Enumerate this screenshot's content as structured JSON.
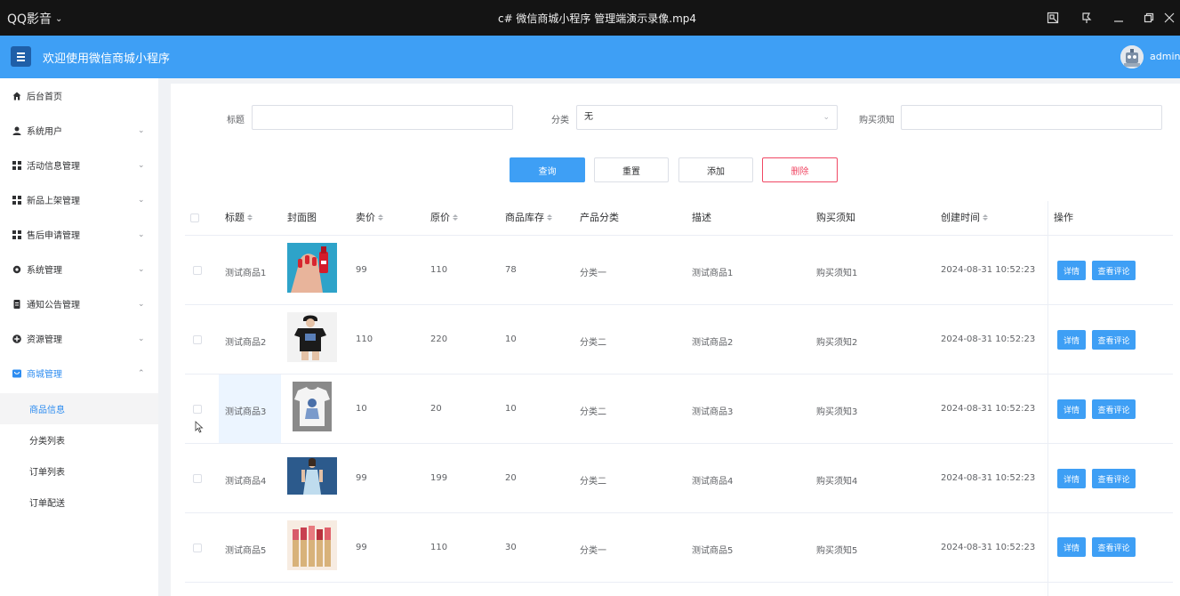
{
  "player": {
    "brand": "QQ影音",
    "title": "c# 微信商城小程序 管理端演示录像.mp4"
  },
  "header": {
    "title": "欢迎使用微信商城小程序",
    "user": "admin"
  },
  "sidebar": {
    "items": [
      {
        "label": "后台首页",
        "icon": "home-icon"
      },
      {
        "label": "系统用户",
        "icon": "user-icon"
      },
      {
        "label": "活动信息管理",
        "icon": "grid-icon"
      },
      {
        "label": "新品上架管理",
        "icon": "grid-icon"
      },
      {
        "label": "售后申请管理",
        "icon": "grid-icon"
      },
      {
        "label": "系统管理",
        "icon": "gear-icon"
      },
      {
        "label": "通知公告管理",
        "icon": "document-icon"
      },
      {
        "label": "资源管理",
        "icon": "plus-circle-icon"
      },
      {
        "label": "商城管理",
        "icon": "shop-icon"
      }
    ],
    "subitems": [
      "商品信息",
      "分类列表",
      "订单列表",
      "订单配送"
    ]
  },
  "filters": {
    "title_label": "标题",
    "title_value": "",
    "category_label": "分类",
    "category_value": "无",
    "notice_label": "购买须知",
    "notice_value": ""
  },
  "actions": {
    "query": "查询",
    "reset": "重置",
    "add": "添加",
    "delete": "删除"
  },
  "table": {
    "headers": {
      "title": "标题",
      "cover": "封面图",
      "price": "卖价",
      "original_price": "原价",
      "stock": "商品库存",
      "category": "产品分类",
      "description": "描述",
      "notice": "购买须知",
      "created": "创建时间",
      "ops": "操作"
    },
    "detail_label": "详情",
    "review_label": "查看评论",
    "rows": [
      {
        "title": "测试商品1",
        "cover": "nail-polish",
        "price": "99",
        "original": "110",
        "stock": "78",
        "category": "分类一",
        "desc": "测试商品1",
        "notice": "购买须知1",
        "created": "2024-08-31 10:52:23"
      },
      {
        "title": "测试商品2",
        "cover": "black-tshirt",
        "price": "110",
        "original": "220",
        "stock": "10",
        "category": "分类二",
        "desc": "测试商品2",
        "notice": "购买须知2",
        "created": "2024-08-31 10:52:23"
      },
      {
        "title": "测试商品3",
        "cover": "white-tshirt",
        "price": "10",
        "original": "20",
        "stock": "10",
        "category": "分类二",
        "desc": "测试商品3",
        "notice": "购买须知3",
        "created": "2024-08-31 10:52:23"
      },
      {
        "title": "测试商品4",
        "cover": "blue-dress",
        "price": "99",
        "original": "199",
        "stock": "20",
        "category": "分类二",
        "desc": "测试商品4",
        "notice": "购买须知4",
        "created": "2024-08-31 10:52:23"
      },
      {
        "title": "测试商品5",
        "cover": "lipsticks",
        "price": "99",
        "original": "110",
        "stock": "30",
        "category": "分类一",
        "desc": "测试商品5",
        "notice": "购买须知5",
        "created": "2024-08-31 10:52:23"
      }
    ]
  },
  "colors": {
    "accent": "#3e9ff5",
    "danger": "#f04864",
    "player_bg": "#141414"
  }
}
